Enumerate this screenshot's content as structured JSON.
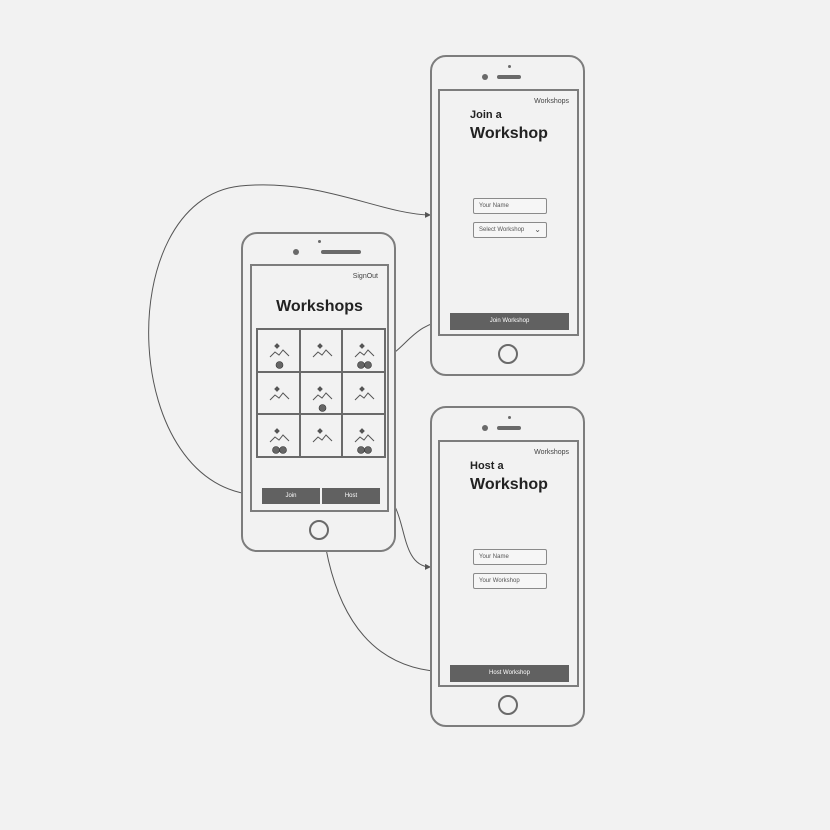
{
  "main_screen": {
    "corner_link": "SignOut",
    "title": "Workshops",
    "join_button": "Join",
    "host_button": "Host",
    "tiles": [
      {
        "id": "tile-1",
        "icon": "image-icon",
        "avatars": 1
      },
      {
        "id": "tile-2",
        "icon": "image-icon",
        "avatars": 0
      },
      {
        "id": "tile-3",
        "icon": "image-icon",
        "avatars": 2
      },
      {
        "id": "tile-4",
        "icon": "image-icon",
        "avatars": 0
      },
      {
        "id": "tile-5",
        "icon": "image-icon",
        "avatars": 1
      },
      {
        "id": "tile-6",
        "icon": "image-icon",
        "avatars": 0
      },
      {
        "id": "tile-7",
        "icon": "image-icon",
        "avatars": 2
      },
      {
        "id": "tile-8",
        "icon": "image-icon",
        "avatars": 0
      },
      {
        "id": "tile-9",
        "icon": "image-icon",
        "avatars": 2
      }
    ]
  },
  "join_screen": {
    "corner_link": "Workshops",
    "title_line1": "Join a",
    "title_line2": "Workshop",
    "name_placeholder": "Your Name",
    "select_label": "Select Workshop",
    "submit_button": "Join Workshop"
  },
  "host_screen": {
    "corner_link": "Workshops",
    "title_line1": "Host a",
    "title_line2": "Workshop",
    "name_placeholder": "Your Name",
    "workshop_placeholder": "Your Workshop",
    "submit_button": "Host Workshop"
  },
  "colors": {
    "background": "#f2f2f2",
    "frame": "#7d7d7d",
    "button": "#616161",
    "connector": "#555555"
  }
}
